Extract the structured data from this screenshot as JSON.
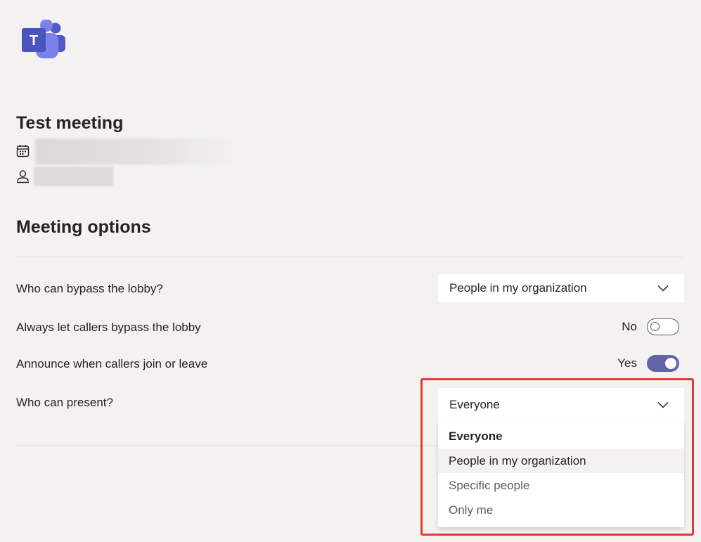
{
  "app": {
    "logo_icon": "teams-logo-icon",
    "logo_letter": "T",
    "brand_color": "#6264a7"
  },
  "meeting": {
    "title": "Test meeting",
    "date_icon": "calendar-icon",
    "organizer_icon": "person-icon"
  },
  "options": {
    "section_title": "Meeting options",
    "bypass_lobby": {
      "label": "Who can bypass the lobby?",
      "value": "People in my organization"
    },
    "callers_bypass": {
      "label": "Always let callers bypass the lobby",
      "state_text": "No",
      "on": false
    },
    "announce_callers": {
      "label": "Announce when callers join or leave",
      "state_text": "Yes",
      "on": true
    },
    "who_can_present": {
      "label": "Who can present?",
      "value": "Everyone",
      "menu_items": [
        "Everyone",
        "People in my organization",
        "Specific people",
        "Only me"
      ]
    }
  },
  "colors": {
    "highlight": "#e03a31",
    "toggle_on": "#6264a7",
    "background": "#f3f2f1"
  }
}
